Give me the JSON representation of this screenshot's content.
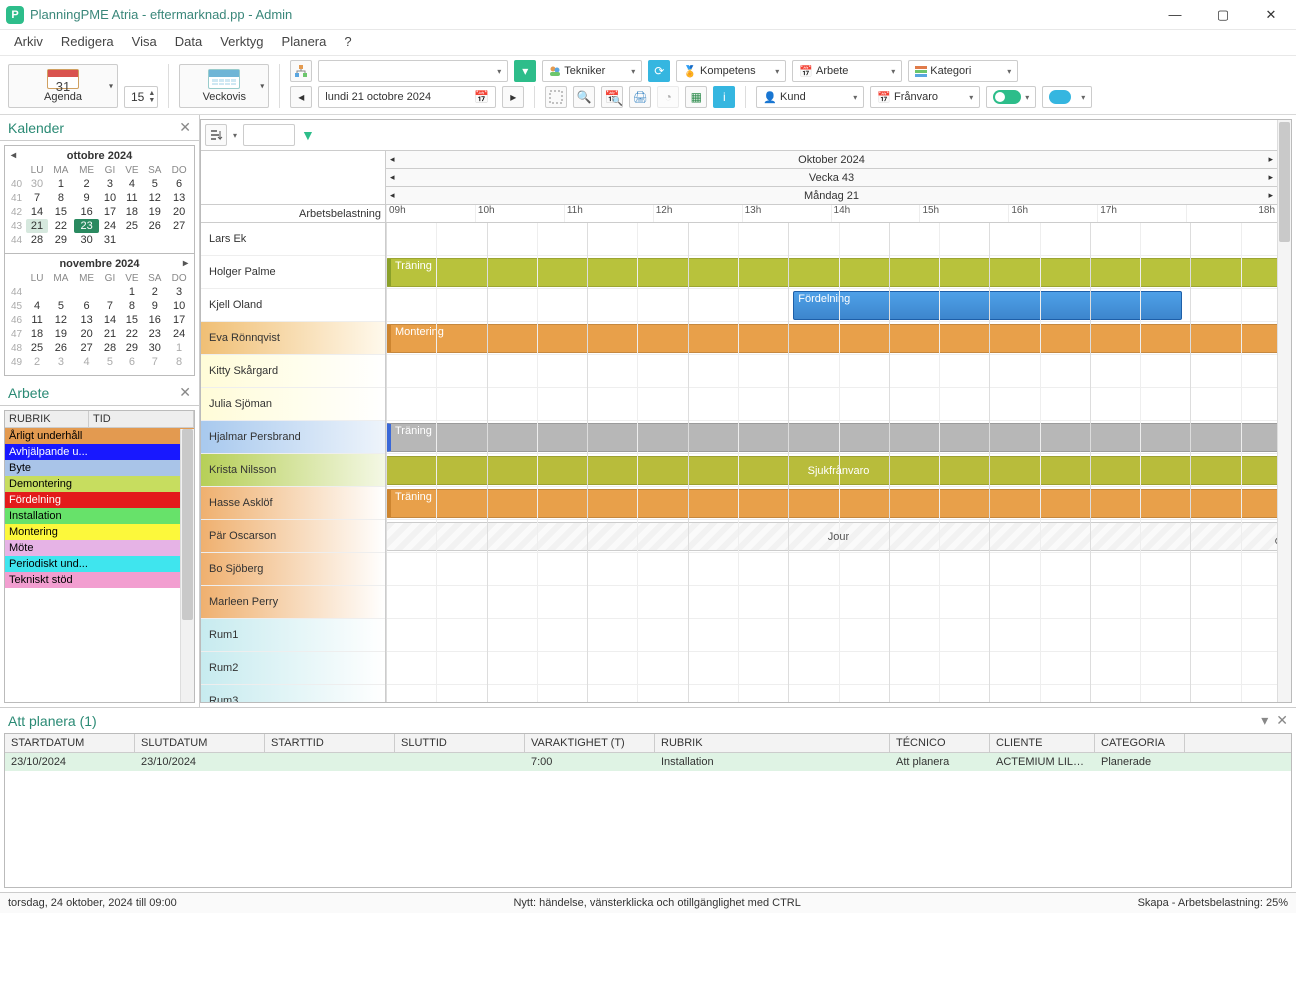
{
  "window_title": "PlanningPME Atria - eftermarknad.pp - Admin",
  "menu": [
    "Arkiv",
    "Redigera",
    "Visa",
    "Data",
    "Verktyg",
    "Planera",
    "?"
  ],
  "toolbar": {
    "agenda_label": "Agenda",
    "agenda_day": "31",
    "step": "15",
    "week_label": "Veckovis",
    "date_text": "lundi    21   octobre   2024",
    "tekniker": "Tekniker",
    "kompetens": "Kompetens",
    "arbete": "Arbete",
    "kategori": "Kategori",
    "kund": "Kund",
    "franvaro": "Frånvaro"
  },
  "kalender_title": "Kalender",
  "month1_title": "ottobre 2024",
  "month2_title": "novembre 2024",
  "dow": [
    "LU",
    "MA",
    "ME",
    "GI",
    "VE",
    "SA",
    "DO"
  ],
  "oct_weeks": [
    {
      "wk": "40",
      "d": [
        "30",
        "1",
        "2",
        "3",
        "4",
        "5",
        "6"
      ],
      "dim": [
        true,
        false,
        false,
        false,
        false,
        false,
        false
      ]
    },
    {
      "wk": "41",
      "d": [
        "7",
        "8",
        "9",
        "10",
        "11",
        "12",
        "13"
      ]
    },
    {
      "wk": "42",
      "d": [
        "14",
        "15",
        "16",
        "17",
        "18",
        "19",
        "20"
      ]
    },
    {
      "wk": "43",
      "d": [
        "21",
        "22",
        "23",
        "24",
        "25",
        "26",
        "27"
      ],
      "sel": 0,
      "today": 2
    },
    {
      "wk": "44",
      "d": [
        "28",
        "29",
        "30",
        "31",
        "",
        "",
        ""
      ]
    }
  ],
  "nov_weeks": [
    {
      "wk": "44",
      "d": [
        "",
        "",
        "",
        "",
        "1",
        "2",
        "3"
      ]
    },
    {
      "wk": "45",
      "d": [
        "4",
        "5",
        "6",
        "7",
        "8",
        "9",
        "10"
      ]
    },
    {
      "wk": "46",
      "d": [
        "11",
        "12",
        "13",
        "14",
        "15",
        "16",
        "17"
      ]
    },
    {
      "wk": "47",
      "d": [
        "18",
        "19",
        "20",
        "21",
        "22",
        "23",
        "24"
      ]
    },
    {
      "wk": "48",
      "d": [
        "25",
        "26",
        "27",
        "28",
        "29",
        "30",
        "1"
      ],
      "dim": [
        false,
        false,
        false,
        false,
        false,
        false,
        true
      ]
    },
    {
      "wk": "49",
      "d": [
        "2",
        "3",
        "4",
        "5",
        "6",
        "7",
        "8"
      ],
      "dim": [
        true,
        true,
        true,
        true,
        true,
        true,
        true
      ]
    }
  ],
  "arbete_title": "Arbete",
  "arbete_cols": [
    "RUBRIK",
    "TID"
  ],
  "arbete_rows": [
    {
      "label": "Årligt underhåll",
      "bg": "#e39a50"
    },
    {
      "label": "Avhjälpande u...",
      "bg": "#1818ff",
      "fg": "#fff"
    },
    {
      "label": "Byte",
      "bg": "#a9c4e8"
    },
    {
      "label": "Demontering",
      "bg": "#c7dd5f"
    },
    {
      "label": "Fördelning",
      "bg": "#e31b1b",
      "fg": "#fff"
    },
    {
      "label": "Installation",
      "bg": "#67e26a"
    },
    {
      "label": "Montering",
      "bg": "#fcf83b"
    },
    {
      "label": "Möte",
      "bg": "#e6b3e6"
    },
    {
      "label": "Periodiskt und...",
      "bg": "#3fe5ee"
    },
    {
      "label": "Tekniskt stöd",
      "bg": "#f29ed0"
    }
  ],
  "sched": {
    "workload_label": "Arbetsbelastning",
    "month_header": "Oktober 2024",
    "week_header": "Vecka 43",
    "day_header": "Måndag 21",
    "hours": [
      "09h",
      "10h",
      "11h",
      "12h",
      "13h",
      "14h",
      "15h",
      "16h",
      "17h",
      "18h"
    ],
    "resources": [
      {
        "name": "Lars Ek",
        "bg": "#ffffff"
      },
      {
        "name": "Holger Palme",
        "bg": "#ffffff"
      },
      {
        "name": "Kjell Oland",
        "bg": "#ffffff"
      },
      {
        "name": "Eva Rönnqvist",
        "bg": "linear-gradient(90deg,#f0bf75,#fff9ec)"
      },
      {
        "name": "Kitty Skårgard",
        "bg": "linear-gradient(90deg,#fffcd8,#ffffff)"
      },
      {
        "name": "Julia Sjöman",
        "bg": "linear-gradient(90deg,#fffcd8,#ffffff)"
      },
      {
        "name": "Hjalmar Persbrand",
        "bg": "linear-gradient(90deg,#a8c9ee,#eef4fb)"
      },
      {
        "name": "Krista Nilsson",
        "bg": "linear-gradient(90deg,#b6cf57,#f4f8e5)"
      },
      {
        "name": "Hasse Asklöf",
        "bg": "linear-gradient(90deg,#efb06f,#fff)"
      },
      {
        "name": "Pär Oscarson",
        "bg": "linear-gradient(90deg,#efb06f,#fff)"
      },
      {
        "name": "Bo Sjöberg",
        "bg": "linear-gradient(90deg,#efb06f,#fff)"
      },
      {
        "name": "Marleen Perry",
        "bg": "linear-gradient(90deg,#efb06f,#fff)"
      },
      {
        "name": "Rum1",
        "bg": "linear-gradient(90deg,#c7ebef,#fff)"
      },
      {
        "name": "Rum2",
        "bg": "linear-gradient(90deg,#c7ebef,#fff)"
      },
      {
        "name": "Rum3",
        "bg": "linear-gradient(90deg,#c7ebef,#fff)"
      },
      {
        "name": "Arbetsbelastning",
        "bg": "linear-gradient(90deg,#1fd335,#7ef18c)",
        "fg": "#fff"
      }
    ],
    "events": [
      {
        "row": 1,
        "label": "Träning",
        "start": 0,
        "end": 100,
        "bg": "#b8c23c",
        "accent": "#8aa02a"
      },
      {
        "row": 2,
        "label": "Fördelning",
        "start": 45,
        "end": 88,
        "bg": "linear-gradient(180deg,#4ea0e8,#3d86cd)",
        "border": "#1e5fa8"
      },
      {
        "row": 3,
        "label": "Montering",
        "start": 0,
        "end": 100,
        "bg": "#e8a04a",
        "accent": "#cd8530"
      },
      {
        "row": 6,
        "label": "Träning",
        "start": 0,
        "end": 100,
        "bg": "#b7b7b7",
        "accent": "#3a68d8"
      },
      {
        "row": 7,
        "label": "Sjukfrånvaro",
        "start": 0,
        "end": 100,
        "bg": "#b8bc3b",
        "hatch": true,
        "center": true
      },
      {
        "row": 8,
        "label": "Träning",
        "start": 0,
        "end": 100,
        "bg": "#e8a04a",
        "accent": "#cd8530"
      },
      {
        "row": 9,
        "label": "Jour",
        "start": 0,
        "end": 100,
        "jour": true
      },
      {
        "row": 15,
        "label": "...",
        "start": 0,
        "end": 100,
        "bg": "#ffffff",
        "fg": "#555",
        "border": "#aac8a0",
        "center": true,
        "thin": true
      }
    ]
  },
  "att_title": "Att planera (1)",
  "att_cols": [
    "STARTDATUM",
    "SLUTDATUM",
    "STARTTID",
    "SLUTTID",
    "VARAKTIGHET (T)",
    "RUBRIK",
    "TÉCNICO",
    "CLIENTE",
    "CATEGORIA"
  ],
  "att_row": {
    "start": "23/10/2024",
    "end": "23/10/2024",
    "starttid": "",
    "sluttid": "",
    "varaktighet": "7:00",
    "rubrik": "Installation",
    "tecnico": "Att planera",
    "cliente": "ACTEMIUM LILLE ...",
    "categoria": "Planerade"
  },
  "status_left": "torsdag, 24 oktober, 2024 till 09:00",
  "status_center": "Nytt: händelse, vänsterklicka och otillgänglighet med CTRL",
  "status_right": "Skapa - Arbetsbelastning: 25%"
}
